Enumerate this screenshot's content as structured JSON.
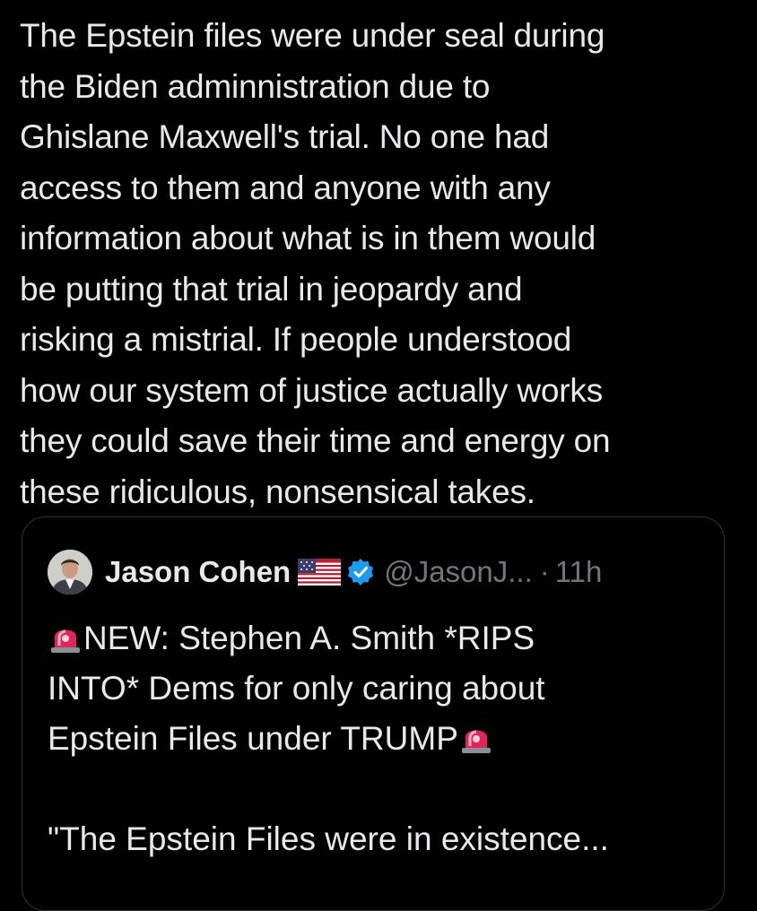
{
  "post": {
    "text": "The Epstein files were under seal during\nthe Biden adminnistration due to\nGhislane Maxwell's trial. No one had\naccess to them and anyone with any\ninformation about what is in them would\nbe putting that trial in jeopardy and\nrisking a mistrial. If people understood\nhow our system of justice actually works\nthey could save their time and energy on\nthese ridiculous, nonsensical takes."
  },
  "quoted": {
    "author_name": "Jason Cohen",
    "handle": "@JasonJ...",
    "separator": "·",
    "time": "11h",
    "line1": "NEW: Stephen A. Smith *RIPS",
    "line2": "INTO* Dems for only caring about",
    "line3": "Epstein Files under TRUMP",
    "line4": "\"The Epstein Files were in existence...",
    "icons": {
      "flag": "us-flag-icon",
      "verified": "verified-badge-icon",
      "siren": "siren-icon"
    }
  },
  "colors": {
    "background": "#000000",
    "text": "#e7e9ea",
    "secondary_text": "#71767b",
    "border": "#2f3336",
    "verified": "#1d9bf0",
    "siren": "#e0245e"
  }
}
